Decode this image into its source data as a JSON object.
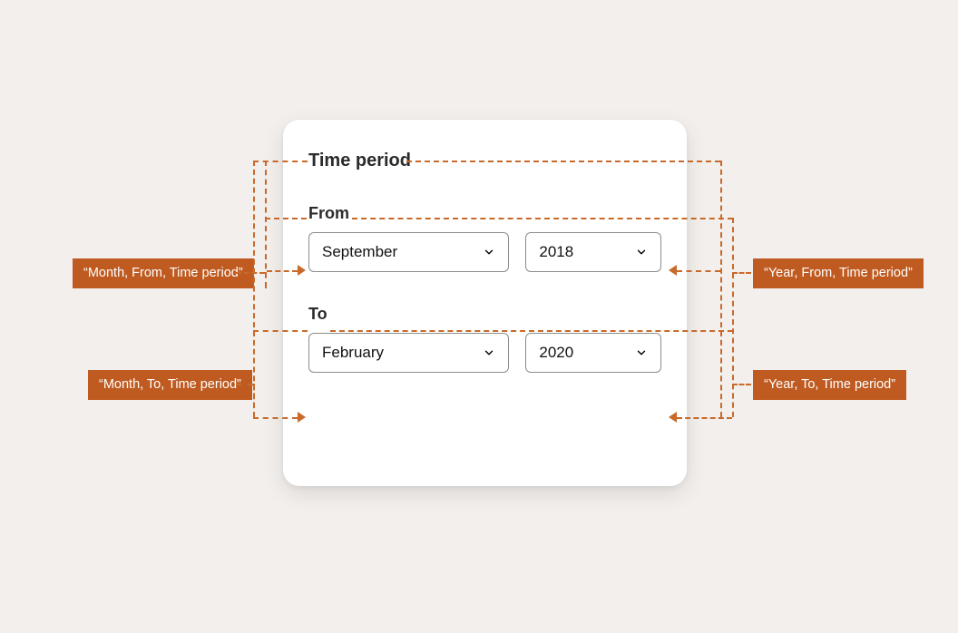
{
  "card": {
    "title": "Time period",
    "from": {
      "label": "From",
      "month": "September",
      "year": "2018"
    },
    "to": {
      "label": "To",
      "month": "February",
      "year": "2020"
    }
  },
  "annotations": {
    "from_month": "“Month, From, Time period”",
    "from_year": "“Year, From, Time period”",
    "to_month": "“Month, To, Time period”",
    "to_year": "“Year, To, Time period”"
  }
}
